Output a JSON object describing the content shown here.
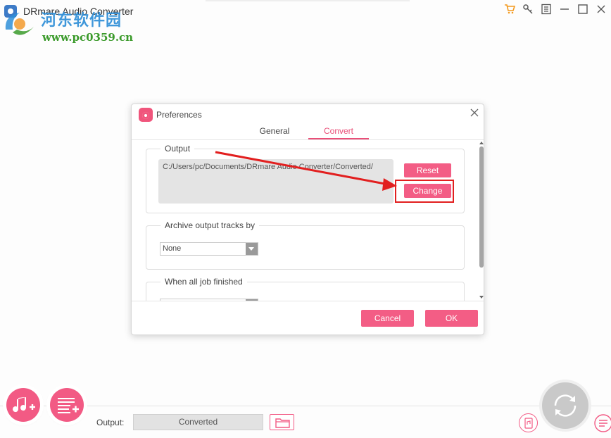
{
  "app": {
    "title": "DRmare Audio Converter"
  },
  "watermark": {
    "name": "河东软件园",
    "url": "www.pc0359.cn"
  },
  "title_controls": [
    "cart-icon",
    "key-icon",
    "menu-icon",
    "minimize-icon",
    "maximize-icon",
    "close-icon"
  ],
  "dialog": {
    "title": "Preferences",
    "tabs": [
      {
        "label": "General",
        "active": false
      },
      {
        "label": "Convert",
        "active": true
      }
    ],
    "output": {
      "label": "Output",
      "path": "C:/Users/pc/Documents/DRmare Audio Converter/Converted/",
      "reset_label": "Reset",
      "change_label": "Change"
    },
    "archive": {
      "label": "Archive output tracks by",
      "selected": "None"
    },
    "finish": {
      "label": "When all job finished"
    },
    "cancel_label": "Cancel",
    "ok_label": "OK"
  },
  "bottom": {
    "output_label": "Output:",
    "output_value": "Converted"
  },
  "colors": {
    "accent": "#f35d85",
    "highlight": "#e21f1f",
    "watermark_blue": "#2f8fd8",
    "watermark_green": "#3a9a2a"
  }
}
